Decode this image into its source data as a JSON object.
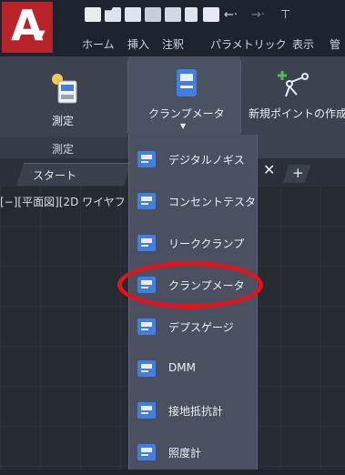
{
  "app": {
    "logo_letter": "A"
  },
  "ribbon_tabs": [
    "ホーム",
    "挿入",
    "注釈",
    "パラメトリック",
    "表示",
    "管"
  ],
  "ribbon": {
    "measure_label": "測定",
    "clamp_meter_label": "クランプメータ",
    "new_point_label": "新規ポイントの作成",
    "panel_title": "測定"
  },
  "file_tabs": {
    "start_label": "スタート",
    "close_glyph": "✕",
    "add_glyph": "+"
  },
  "viewport_label": "[−][平面図][2D ワイヤフ",
  "dropdown": {
    "items": [
      "デジタルノギス",
      "コンセントテスタ",
      "リーククランプ",
      "クランプメータ",
      "デプスゲージ",
      "DMM",
      "接地抵抗計",
      "照度計"
    ],
    "highlighted": "クランプメータ"
  },
  "colors": {
    "app_red": "#b8232a",
    "icon_blue": "#3f7fe4",
    "highlight_red": "#e5121b",
    "new_point_green": "#47c24a"
  }
}
